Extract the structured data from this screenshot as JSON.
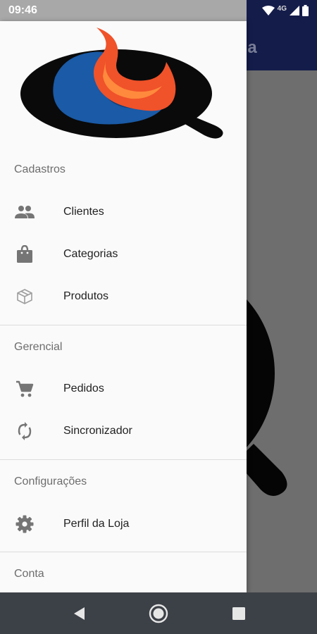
{
  "status_bar": {
    "time": "09:46",
    "network": "4G"
  },
  "app_bar": {
    "title_fragment": "nda"
  },
  "drawer": {
    "sections": [
      {
        "title": "Cadastros",
        "items": [
          {
            "label": "Clientes",
            "icon": "people-icon"
          },
          {
            "label": "Categorias",
            "icon": "shopping-bag-icon"
          },
          {
            "label": "Produtos",
            "icon": "box-icon"
          }
        ]
      },
      {
        "title": "Gerencial",
        "items": [
          {
            "label": "Pedidos",
            "icon": "cart-icon"
          },
          {
            "label": "Sincronizador",
            "icon": "sync-icon"
          }
        ]
      },
      {
        "title": "Configurações",
        "items": [
          {
            "label": "Perfil da Loja",
            "icon": "gear-icon"
          }
        ]
      },
      {
        "title": "Conta",
        "items": []
      }
    ]
  },
  "colors": {
    "app_bar": "#141c4a",
    "logo_blue": "#1a5aa6",
    "logo_orange": "#f0522a",
    "logo_black": "#0a0a0a"
  }
}
